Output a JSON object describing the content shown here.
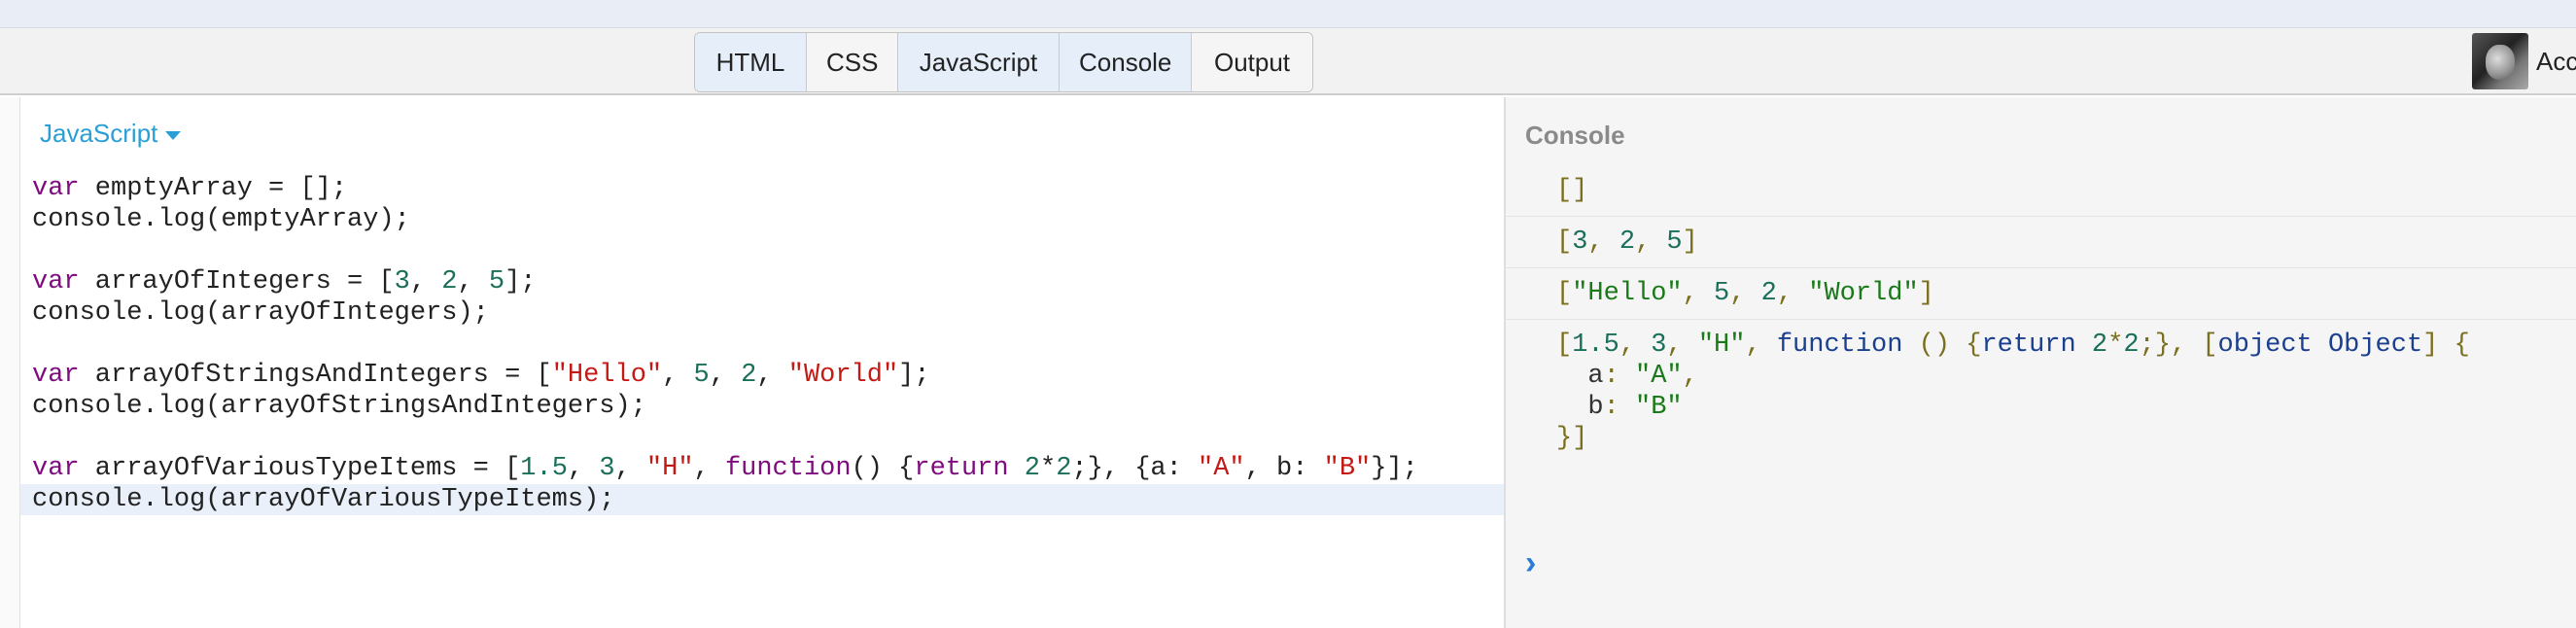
{
  "toolbar": {
    "tabs": [
      {
        "label": "HTML",
        "active": true
      },
      {
        "label": "CSS",
        "active": false
      },
      {
        "label": "JavaScript",
        "active": true
      },
      {
        "label": "Console",
        "active": true
      },
      {
        "label": "Output",
        "active": false
      }
    ],
    "account_label": "Acc"
  },
  "editor": {
    "language": "JavaScript",
    "active_line": 11
  },
  "console": {
    "title": "Console",
    "prompt_symbol": "›"
  },
  "colors": {
    "keyword": "#7f0c7f",
    "number": "#1a6f5a",
    "string": "#c41a16",
    "link": "#2a9fd6"
  }
}
